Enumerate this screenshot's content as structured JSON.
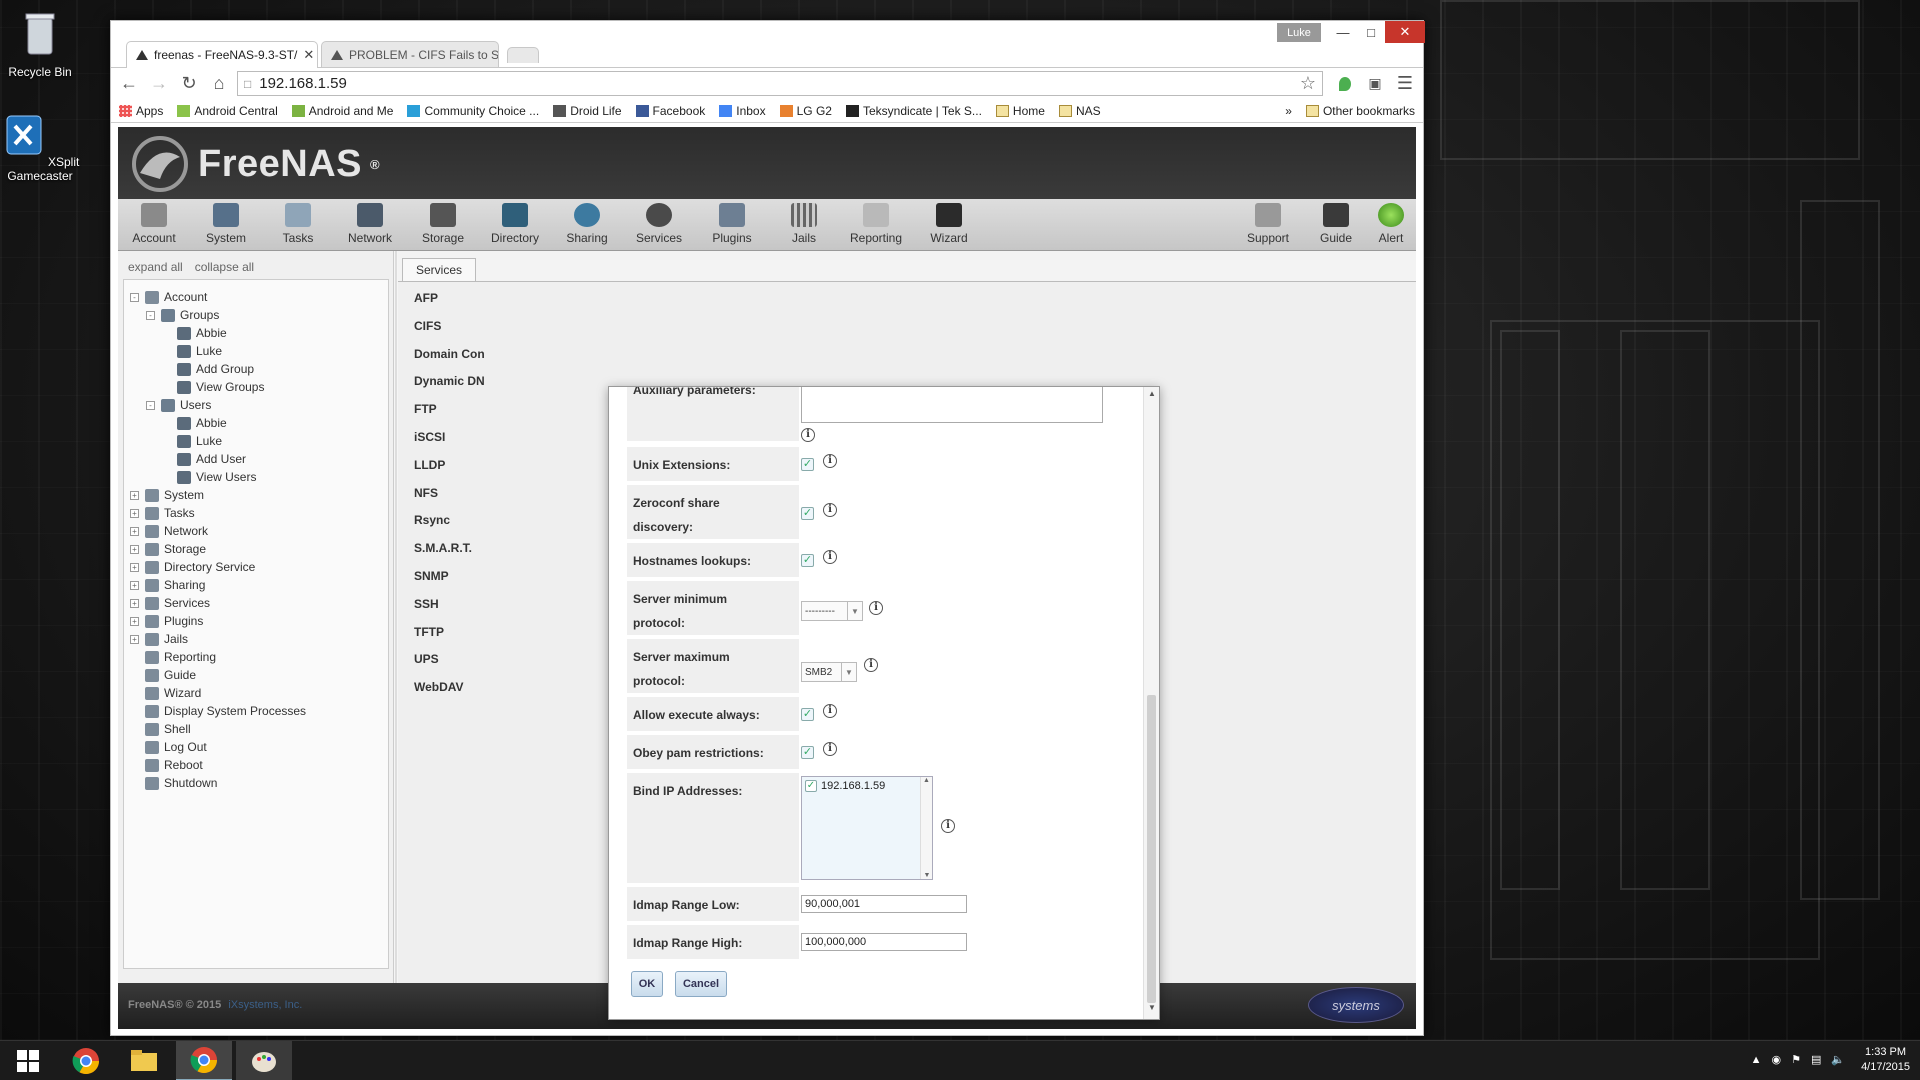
{
  "desktop": {
    "icons": [
      {
        "label": "Recycle Bin"
      },
      {
        "label": "XSplit\nGamecaster"
      }
    ]
  },
  "browser": {
    "profile": "Luke",
    "tabs": [
      {
        "title": "freenas - FreeNAS-9.3-ST/",
        "active": true
      },
      {
        "title": "PROBLEM - CIFS Fails to S",
        "active": false
      }
    ],
    "address": "192.168.1.59",
    "bookmarks": [
      "Apps",
      "Android Central",
      "Android and Me",
      "Community Choice ...",
      "Droid Life",
      "Facebook",
      "Inbox",
      "LG G2",
      "Teksyndicate | Tek S...",
      "Home",
      "NAS"
    ],
    "overflow": "»",
    "other_bookmarks": "Other bookmarks"
  },
  "freenas": {
    "logo": "FreeNAS",
    "logo_mark": "®",
    "menu": [
      "Account",
      "System",
      "Tasks",
      "Network",
      "Storage",
      "Directory",
      "Sharing",
      "Services",
      "Plugins",
      "Jails",
      "Reporting",
      "Wizard"
    ],
    "menu_right": [
      "Support",
      "Guide",
      "Alert"
    ],
    "tree_links": {
      "expand": "expand all",
      "collapse": "collapse all"
    },
    "tree": [
      {
        "label": "Account",
        "level": 0,
        "pm": "-"
      },
      {
        "label": "Groups",
        "level": 1,
        "pm": "-"
      },
      {
        "label": "Abbie",
        "level": 2
      },
      {
        "label": "Luke",
        "level": 2
      },
      {
        "label": "Add Group",
        "level": 2
      },
      {
        "label": "View Groups",
        "level": 2
      },
      {
        "label": "Users",
        "level": 1,
        "pm": "-"
      },
      {
        "label": "Abbie",
        "level": 2
      },
      {
        "label": "Luke",
        "level": 2
      },
      {
        "label": "Add User",
        "level": 2
      },
      {
        "label": "View Users",
        "level": 2
      },
      {
        "label": "System",
        "level": 0,
        "pm": "+"
      },
      {
        "label": "Tasks",
        "level": 0,
        "pm": "+"
      },
      {
        "label": "Network",
        "level": 0,
        "pm": "+"
      },
      {
        "label": "Storage",
        "level": 0,
        "pm": "+"
      },
      {
        "label": "Directory Service",
        "level": 0,
        "pm": "+"
      },
      {
        "label": "Sharing",
        "level": 0,
        "pm": "+"
      },
      {
        "label": "Services",
        "level": 0,
        "pm": "+"
      },
      {
        "label": "Plugins",
        "level": 0,
        "pm": "+"
      },
      {
        "label": "Jails",
        "level": 0,
        "pm": "+"
      },
      {
        "label": "Reporting",
        "level": 0
      },
      {
        "label": "Guide",
        "level": 0
      },
      {
        "label": "Wizard",
        "level": 0
      },
      {
        "label": "Display System Processes",
        "level": 0
      },
      {
        "label": "Shell",
        "level": 0
      },
      {
        "label": "Log Out",
        "level": 0
      },
      {
        "label": "Reboot",
        "level": 0
      },
      {
        "label": "Shutdown",
        "level": 0
      }
    ],
    "services_tab": "Services",
    "services": [
      "AFP",
      "CIFS",
      "Domain Con",
      "Dynamic DN",
      "FTP",
      "iSCSI",
      "LLDP",
      "NFS",
      "Rsync",
      "S.M.A.R.T.",
      "SNMP",
      "SSH",
      "TFTP",
      "UPS",
      "WebDAV"
    ],
    "footer": {
      "copyright": "FreeNAS® © 2015",
      "company": "iXsystems, Inc.",
      "brand": "systems"
    }
  },
  "dialog": {
    "aux_label": "Auxiliary parameters:",
    "unix_ext": "Unix Extensions:",
    "zeroconf_line1": "Zeroconf share",
    "zeroconf_line2": "discovery:",
    "hostnames": "Hostnames lookups:",
    "min_proto_line1": "Server minimum",
    "min_proto_line2": "protocol:",
    "min_proto_value": "---------",
    "max_proto_line1": "Server maximum",
    "max_proto_line2": "protocol:",
    "max_proto_value": "SMB2",
    "allow_exec": "Allow execute always:",
    "obey_pam": "Obey pam restrictions:",
    "bind_ip": "Bind IP Addresses:",
    "bind_ip_item": "192.168.1.59",
    "idmap_low": "Idmap Range Low:",
    "idmap_low_value": "90,000,001",
    "idmap_high": "Idmap Range High:",
    "idmap_high_value": "100,000,000",
    "ok": "OK",
    "cancel": "Cancel",
    "check": "✓",
    "info": "i"
  },
  "taskbar": {
    "time": "1:33 PM",
    "date": "4/17/2015"
  }
}
